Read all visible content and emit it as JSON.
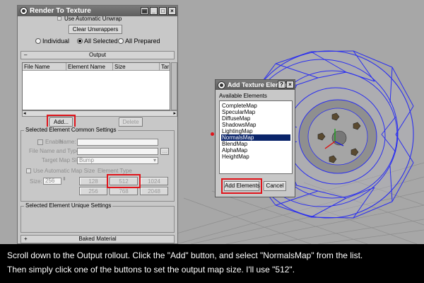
{
  "colors": {
    "highlight_red": "#e0141b",
    "selection_blue": "#0a246a",
    "wire_blue": "#2a2ef0",
    "caption_bg": "#000000"
  },
  "render_to_texture": {
    "title": "Render To Texture",
    "title_buttons": [
      "▤",
      "_",
      "□",
      "×"
    ],
    "use_automatic_unwrap": "Use Automatic Unwrap",
    "clear_unwrappers": "Clear Unwrappers",
    "scope": {
      "individual": "Individual",
      "all_selected": "All Selected",
      "all_prepared": "All Prepared",
      "selected": "All Selected"
    },
    "output_rollout": {
      "sign": "–",
      "label": "Output"
    },
    "table_headers": [
      "File Name",
      "Element Name",
      "Size",
      "Tar"
    ],
    "add_button": "Add...",
    "delete_button": "Delete",
    "common_settings": {
      "title": "Selected Element Common Settings",
      "enable": "Enable",
      "name_label": "Name:",
      "file_name_label": "File Name and Type:",
      "file_browse": "...",
      "target_map_slot_label": "Target Map Slot:",
      "target_map_slot_value": "Bump",
      "use_automatic_map_size": "Use Automatic Map Size",
      "element_type": "Element Type",
      "size_label": "Size:",
      "size_value": "256",
      "size_buttons": [
        "128",
        "512",
        "1024",
        "256",
        "768",
        "2048"
      ]
    },
    "unique_settings": "Selected Element Unique Settings",
    "baked_material_rollout": {
      "sign": "+",
      "label": "Baked Material"
    }
  },
  "add_texture_element": {
    "title": "Add Texture Element",
    "title_buttons": [
      "?",
      "×"
    ],
    "available_label": "Available Elements",
    "elements": [
      "CompleteMap",
      "SpecularMap",
      "DiffuseMap",
      "ShadowsMap",
      "LightingMap",
      "NormalsMap",
      "BlendMap",
      "AlphaMap",
      "HeightMap"
    ],
    "selected": "NormalsMap",
    "add_button": "Add Elements",
    "cancel_button": "Cancel"
  },
  "caption": {
    "line1": "Scroll down to the Output rollout. Click the \"Add\" button, and select \"NormalsMap\" from the list.",
    "line2": "Then simply click one of the buttons to set the output map size. I'll use \"512\"."
  }
}
